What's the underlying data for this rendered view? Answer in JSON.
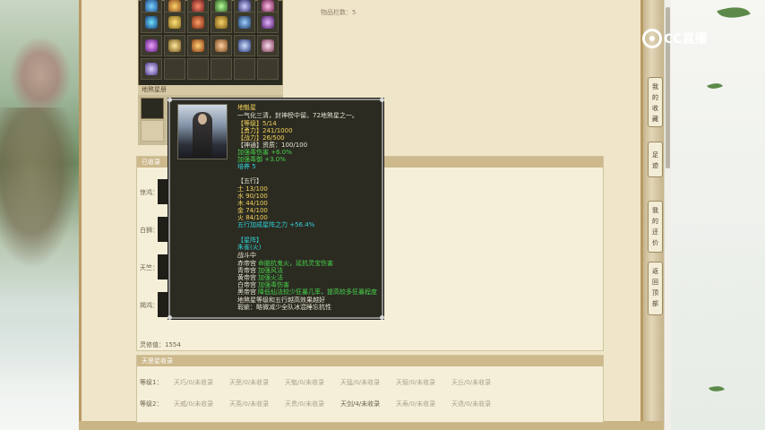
{
  "inventory": {
    "count_label": "物品栏数：5"
  },
  "shenmo": {
    "header": "地煞星册"
  },
  "collection": {
    "header": "已收录",
    "rows": [
      {
        "label": "惊鸿："
      },
      {
        "label": "白狮："
      },
      {
        "label": "天竺："
      },
      {
        "label": "揭鸿："
      }
    ],
    "lingxiu": "灵修值：1554"
  },
  "tiangang": {
    "header": "天罡星收录",
    "rows": [
      {
        "label": "等级1：",
        "cells": [
          {
            "text": "天巧/0/未收录",
            "hl": false
          },
          {
            "text": "天罡/0/未收录",
            "hl": false
          },
          {
            "text": "天魁/0/未收录",
            "hl": false
          },
          {
            "text": "天猛/0/未收录",
            "hl": false
          },
          {
            "text": "天智/0/未收录",
            "hl": false
          },
          {
            "text": "天丘/0/未收录",
            "hl": false
          }
        ]
      },
      {
        "label": "等级2：",
        "cells": [
          {
            "text": "天威/0/未收录",
            "hl": false
          },
          {
            "text": "天英/0/未收录",
            "hl": false
          },
          {
            "text": "天贵/0/未收录",
            "hl": false
          },
          {
            "text": "天剑/4/未收录",
            "hl": true
          },
          {
            "text": "天寿/0/未收录",
            "hl": false
          },
          {
            "text": "天退/0/未收录",
            "hl": false
          }
        ]
      }
    ]
  },
  "side_nav": [
    {
      "label": "我的收藏",
      "chars": [
        "我",
        "的",
        "收",
        "藏"
      ]
    },
    {
      "label": "足迹",
      "chars": [
        "足",
        "迹"
      ]
    },
    {
      "label": "我的还价",
      "chars": [
        "我",
        "的",
        "还",
        "价"
      ]
    },
    {
      "label": "返回顶部",
      "chars": [
        "返",
        "回",
        "顶",
        "部"
      ]
    }
  ],
  "brand": {
    "text": "CC直播"
  },
  "tooltip": {
    "name": "地魁星",
    "desc": "一气化三清，封神榜中留。72地煞星之一。",
    "level": "【等级】5/14",
    "yongli": "【勇力】241/1000",
    "zhanli": "【战力】26/500",
    "shentong": "【神通】资质：100/100",
    "bonus1": "加强毒伤害 +6.0%",
    "bonus2": "加强毒御 +3.0%",
    "peiyang": "培养 5",
    "wuxing_title": "【五行】",
    "wuxing": [
      "土 13/100",
      "水 90/100",
      "木 44/100",
      "金 74/100",
      "火 84/100"
    ],
    "wuxing_bonus": "五行加成星阵之力 +56.4%",
    "xingzhen_title": "【星阵】",
    "xingzhen_sub": "朱雀(火)",
    "battle": "战斗中",
    "gongs": [
      {
        "name": "赤帝宫",
        "effect": "命脑抗鬼火，延抗灵宝伤害"
      },
      {
        "name": "青帝宫",
        "effect": "加强风法"
      },
      {
        "name": "黄帝宫",
        "effect": "加强火法"
      },
      {
        "name": "白帝宫",
        "effect": "加强毒伤害"
      },
      {
        "name": "黑帝宫",
        "effect": "降低仙法较少狂暴几率，提高较多狂暴程度"
      }
    ],
    "note1": "地煞星等级和五行越高效果越好",
    "note2": "瑕疵：略微减少全队冰混睡忘抗性"
  },
  "colors": {
    "tooltip_bg": "#2c2b22",
    "gold": "#f2d25a",
    "green": "#46d24a",
    "cyan": "#2fd3d8"
  }
}
